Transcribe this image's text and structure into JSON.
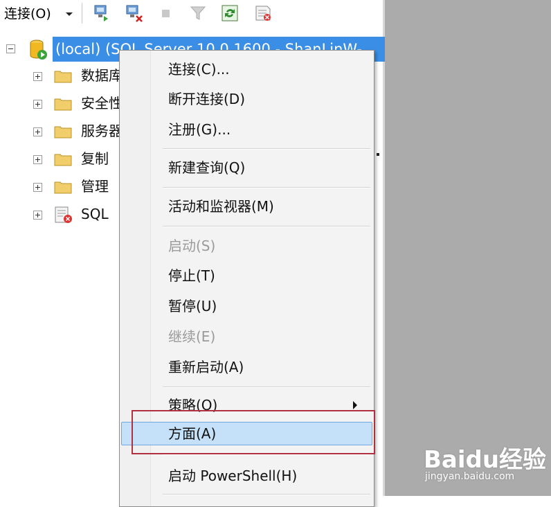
{
  "toolbar": {
    "connect_label": "连接(O)",
    "icons": [
      "connect-object-explorer-icon",
      "disconnect-icon",
      "stop-icon",
      "filter-icon",
      "refresh-icon",
      "stop-powershell-icon"
    ]
  },
  "tree": {
    "root_label": "(local) (SQL Server 10.0.1600 - ShanLinW-",
    "items": [
      {
        "label": "数据库",
        "icon": "folder-icon"
      },
      {
        "label": "安全性",
        "icon": "folder-icon"
      },
      {
        "label": "服务器对象",
        "icon": "folder-icon"
      },
      {
        "label": "复制",
        "icon": "folder-icon"
      },
      {
        "label": "管理",
        "icon": "folder-icon"
      },
      {
        "label": "SQL",
        "icon": "sql-agent-icon"
      }
    ]
  },
  "context_menu": {
    "items": [
      {
        "label": "连接(C)...",
        "enabled": true
      },
      {
        "label": "断开连接(D)",
        "enabled": true
      },
      {
        "label": "注册(G)...",
        "enabled": true
      },
      {
        "label": "新建查询(Q)",
        "enabled": true
      },
      {
        "label": "活动和监视器(M)",
        "enabled": true
      },
      {
        "label": "启动(S)",
        "enabled": false
      },
      {
        "label": "停止(T)",
        "enabled": true
      },
      {
        "label": "暂停(U)",
        "enabled": true
      },
      {
        "label": "继续(E)",
        "enabled": false
      },
      {
        "label": "重新启动(A)",
        "enabled": true
      },
      {
        "label": "策略(O)",
        "enabled": true,
        "submenu": true
      },
      {
        "label": "方面(A)",
        "enabled": true,
        "selected": true
      },
      {
        "label": "启动 PowerShell(H)",
        "enabled": true
      }
    ]
  },
  "watermark": {
    "brand": "Baidu经验",
    "site": "jingyan.baidu.com"
  },
  "colors": {
    "selection": "#3a8ee6",
    "menu_highlight": "#c5e1f9",
    "annotation_box": "#b03040"
  }
}
